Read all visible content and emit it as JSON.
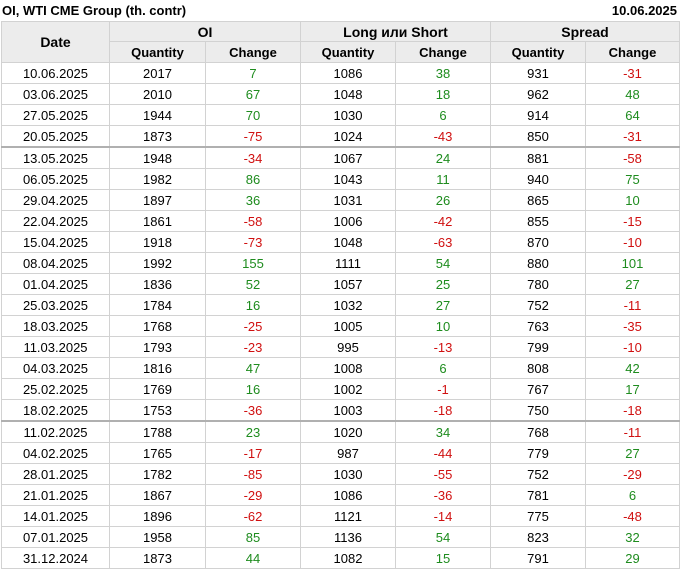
{
  "title": "OI, WTI CME Group (th. contr)",
  "report_date": "10.06.2025",
  "columns": {
    "date": "Date",
    "groups": [
      "OI",
      "Long или Short",
      "Spread"
    ],
    "quantity": "Quantity",
    "change": "Change"
  },
  "colors": {
    "positive": "#1e8c1e",
    "negative": "#d01010",
    "header_bg": "#ececec",
    "grid": "#d2d2d2"
  },
  "rows": [
    {
      "date": "10.06.2025",
      "oi_q": "2017",
      "oi_c": "7",
      "ls_q": "1086",
      "ls_c": "38",
      "sp_q": "931",
      "sp_c": "-31"
    },
    {
      "date": "03.06.2025",
      "oi_q": "2010",
      "oi_c": "67",
      "ls_q": "1048",
      "ls_c": "18",
      "sp_q": "962",
      "sp_c": "48"
    },
    {
      "date": "27.05.2025",
      "oi_q": "1944",
      "oi_c": "70",
      "ls_q": "1030",
      "ls_c": "6",
      "sp_q": "914",
      "sp_c": "64"
    },
    {
      "date": "20.05.2025",
      "oi_q": "1873",
      "oi_c": "-75",
      "ls_q": "1024",
      "ls_c": "-43",
      "sp_q": "850",
      "sp_c": "-31"
    },
    {
      "date": "13.05.2025",
      "oi_q": "1948",
      "oi_c": "-34",
      "ls_q": "1067",
      "ls_c": "24",
      "sp_q": "881",
      "sp_c": "-58"
    },
    {
      "date": "06.05.2025",
      "oi_q": "1982",
      "oi_c": "86",
      "ls_q": "1043",
      "ls_c": "11",
      "sp_q": "940",
      "sp_c": "75"
    },
    {
      "date": "29.04.2025",
      "oi_q": "1897",
      "oi_c": "36",
      "ls_q": "1031",
      "ls_c": "26",
      "sp_q": "865",
      "sp_c": "10"
    },
    {
      "date": "22.04.2025",
      "oi_q": "1861",
      "oi_c": "-58",
      "ls_q": "1006",
      "ls_c": "-42",
      "sp_q": "855",
      "sp_c": "-15"
    },
    {
      "date": "15.04.2025",
      "oi_q": "1918",
      "oi_c": "-73",
      "ls_q": "1048",
      "ls_c": "-63",
      "sp_q": "870",
      "sp_c": "-10"
    },
    {
      "date": "08.04.2025",
      "oi_q": "1992",
      "oi_c": "155",
      "ls_q": "1111",
      "ls_c": "54",
      "sp_q": "880",
      "sp_c": "101"
    },
    {
      "date": "01.04.2025",
      "oi_q": "1836",
      "oi_c": "52",
      "ls_q": "1057",
      "ls_c": "25",
      "sp_q": "780",
      "sp_c": "27"
    },
    {
      "date": "25.03.2025",
      "oi_q": "1784",
      "oi_c": "16",
      "ls_q": "1032",
      "ls_c": "27",
      "sp_q": "752",
      "sp_c": "-11"
    },
    {
      "date": "18.03.2025",
      "oi_q": "1768",
      "oi_c": "-25",
      "ls_q": "1005",
      "ls_c": "10",
      "sp_q": "763",
      "sp_c": "-35"
    },
    {
      "date": "11.03.2025",
      "oi_q": "1793",
      "oi_c": "-23",
      "ls_q": "995",
      "ls_c": "-13",
      "sp_q": "799",
      "sp_c": "-10"
    },
    {
      "date": "04.03.2025",
      "oi_q": "1816",
      "oi_c": "47",
      "ls_q": "1008",
      "ls_c": "6",
      "sp_q": "808",
      "sp_c": "42"
    },
    {
      "date": "25.02.2025",
      "oi_q": "1769",
      "oi_c": "16",
      "ls_q": "1002",
      "ls_c": "-1",
      "sp_q": "767",
      "sp_c": "17"
    },
    {
      "date": "18.02.2025",
      "oi_q": "1753",
      "oi_c": "-36",
      "ls_q": "1003",
      "ls_c": "-18",
      "sp_q": "750",
      "sp_c": "-18"
    },
    {
      "date": "11.02.2025",
      "oi_q": "1788",
      "oi_c": "23",
      "ls_q": "1020",
      "ls_c": "34",
      "sp_q": "768",
      "sp_c": "-11"
    },
    {
      "date": "04.02.2025",
      "oi_q": "1765",
      "oi_c": "-17",
      "ls_q": "987",
      "ls_c": "-44",
      "sp_q": "779",
      "sp_c": "27"
    },
    {
      "date": "28.01.2025",
      "oi_q": "1782",
      "oi_c": "-85",
      "ls_q": "1030",
      "ls_c": "-55",
      "sp_q": "752",
      "sp_c": "-29"
    },
    {
      "date": "21.01.2025",
      "oi_q": "1867",
      "oi_c": "-29",
      "ls_q": "1086",
      "ls_c": "-36",
      "sp_q": "781",
      "sp_c": "6"
    },
    {
      "date": "14.01.2025",
      "oi_q": "1896",
      "oi_c": "-62",
      "ls_q": "1121",
      "ls_c": "-14",
      "sp_q": "775",
      "sp_c": "-48"
    },
    {
      "date": "07.01.2025",
      "oi_q": "1958",
      "oi_c": "85",
      "ls_q": "1136",
      "ls_c": "54",
      "sp_q": "823",
      "sp_c": "32"
    },
    {
      "date": "31.12.2024",
      "oi_q": "1873",
      "oi_c": "44",
      "ls_q": "1082",
      "ls_c": "15",
      "sp_q": "791",
      "sp_c": "29"
    }
  ]
}
